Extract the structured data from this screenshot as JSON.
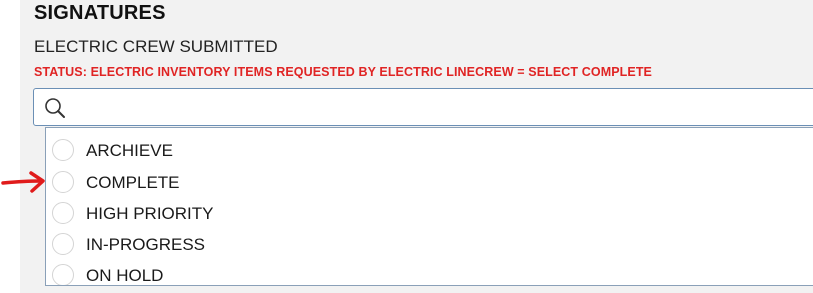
{
  "section": {
    "title": "SIGNATURES"
  },
  "field": {
    "label": "ELECTRIC CREW SUBMITTED",
    "status": "STATUS: ELECTRIC INVENTORY ITEMS REQUESTED BY ELECTRIC LINECREW = SELECT COMPLETE"
  },
  "search": {
    "value": "",
    "placeholder": ""
  },
  "options": [
    {
      "label": "ARCHIEVE"
    },
    {
      "label": "COMPLETE"
    },
    {
      "label": "HIGH PRIORITY"
    },
    {
      "label": "IN-PROGRESS"
    },
    {
      "label": "ON HOLD"
    }
  ],
  "colors": {
    "status_red": "#e02424",
    "arrow_red": "#e01b1b",
    "input_border": "#6b8fb5"
  },
  "icons": {
    "search": "magnifier-icon",
    "annotation": "red-arrow-icon"
  }
}
